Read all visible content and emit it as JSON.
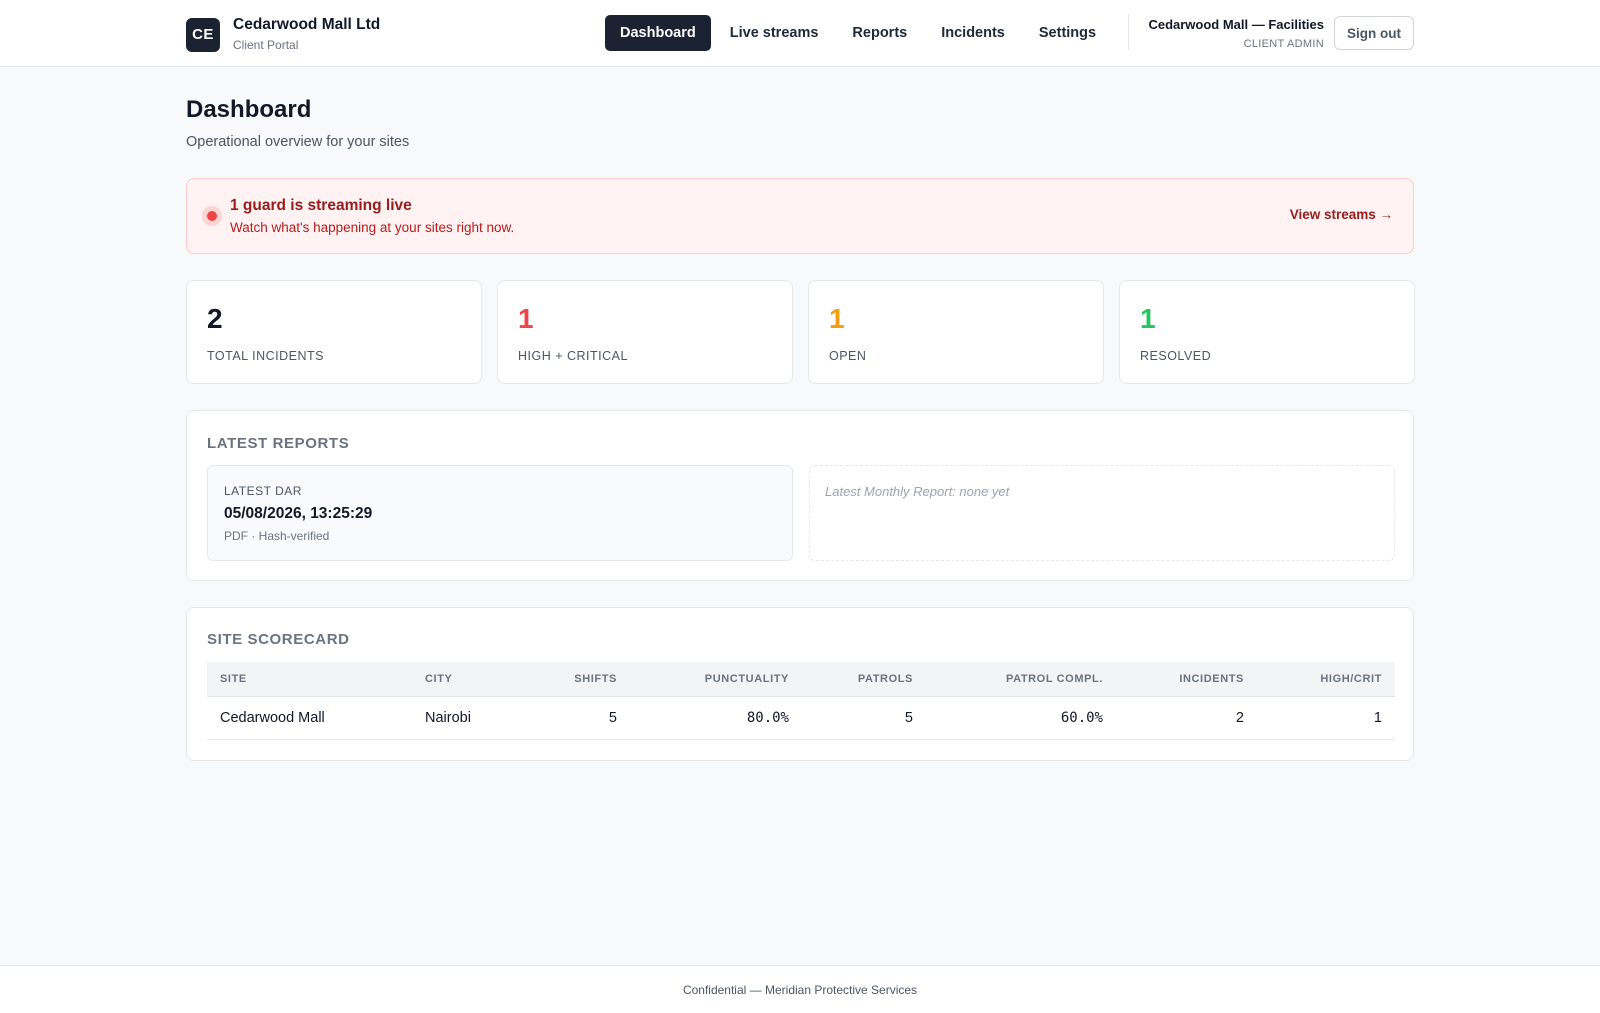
{
  "header": {
    "logo_initials": "CE",
    "company_name": "Cedarwood Mall Ltd",
    "portal_label": "Client Portal",
    "nav": [
      {
        "label": "Dashboard",
        "active": true
      },
      {
        "label": "Live streams",
        "active": false
      },
      {
        "label": "Reports",
        "active": false
      },
      {
        "label": "Incidents",
        "active": false
      },
      {
        "label": "Settings",
        "active": false
      }
    ],
    "user_name": "Cedarwood Mall — Facilities",
    "user_role": "CLIENT ADMIN",
    "signout_label": "Sign out"
  },
  "page": {
    "title": "Dashboard",
    "subtitle": "Operational overview for your sites"
  },
  "live_banner": {
    "title": "1 guard is streaming live",
    "subtitle": "Watch what's happening at your sites right now.",
    "link_label": "View streams →",
    "indicator_color": "#ef4444"
  },
  "stats": [
    {
      "value": "2",
      "label": "TOTAL INCIDENTS",
      "color": "#111827"
    },
    {
      "value": "1",
      "label": "HIGH + CRITICAL",
      "color": "#ef4444"
    },
    {
      "value": "1",
      "label": "OPEN",
      "color": "#f59e0b"
    },
    {
      "value": "1",
      "label": "RESOLVED",
      "color": "#22c55e"
    }
  ],
  "latest_reports": {
    "title": "LATEST REPORTS",
    "dar": {
      "label": "LATEST DAR",
      "datetime": "05/08/2026, 13:25:29",
      "meta": "PDF · Hash-verified"
    },
    "monthly_empty": "Latest Monthly Report: none yet"
  },
  "scorecard": {
    "title": "SITE SCORECARD",
    "columns": [
      "SITE",
      "CITY",
      "SHIFTS",
      "PUNCTUALITY",
      "PATROLS",
      "PATROL COMPL.",
      "INCIDENTS",
      "HIGH/CRIT"
    ],
    "rows": [
      [
        "Cedarwood Mall",
        "Nairobi",
        "5",
        "80.0%",
        "5",
        "60.0%",
        "2",
        "1"
      ]
    ]
  },
  "footer": {
    "text": "Confidential — Meridian Protective Services"
  }
}
